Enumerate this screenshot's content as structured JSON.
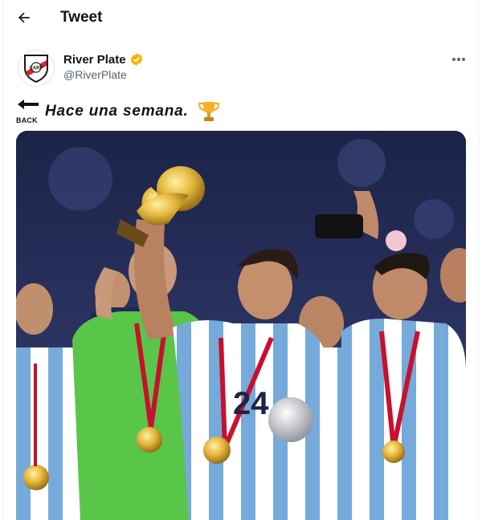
{
  "header": {
    "title": "Tweet",
    "back_icon": "arrow-left-icon"
  },
  "author": {
    "name": "River Plate",
    "handle": "@RiverPlate",
    "verified_badge_color": "#f4b400",
    "avatar_icon": "river-plate-crest"
  },
  "menu": {
    "more_icon": "more-horizontal-icon"
  },
  "tweet": {
    "back_emoji_label": "BACK",
    "text": "Hace una semana.",
    "trophy_icon": "trophy-icon"
  },
  "media": {
    "description_icon": "photo-world-cup-celebration",
    "jersey_number": "24"
  },
  "colors": {
    "text": "#0f1419",
    "secondary": "#536471",
    "crest_red": "#d8242f",
    "argentina_blue": "#75aadb"
  }
}
